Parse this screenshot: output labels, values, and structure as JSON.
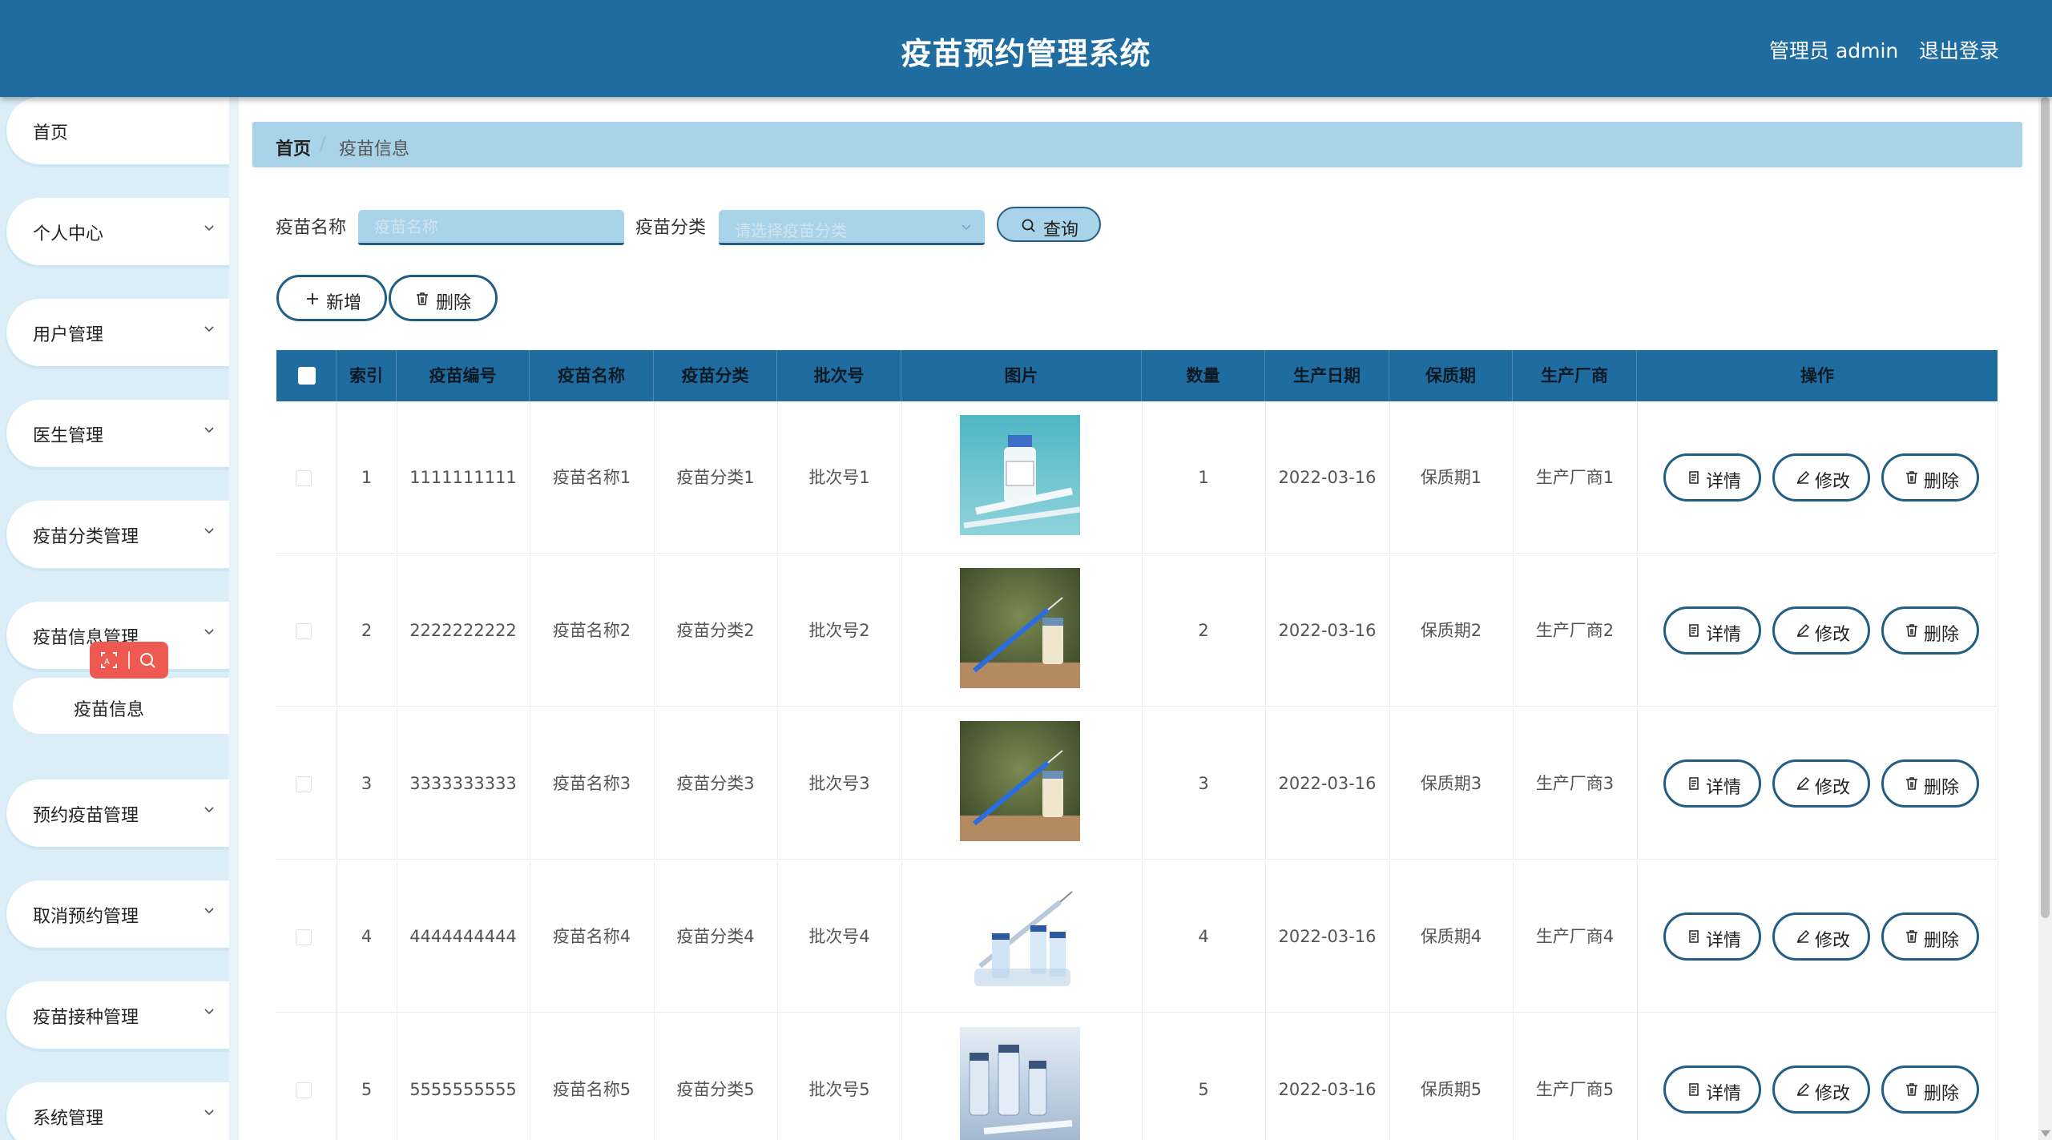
{
  "header": {
    "title": "疫苗预约管理系统",
    "admin": "管理员 admin",
    "logout": "退出登录"
  },
  "sidebar": {
    "items": [
      {
        "label": "首页",
        "has_arrow": false
      },
      {
        "label": "个人中心",
        "has_arrow": true
      },
      {
        "label": "用户管理",
        "has_arrow": true
      },
      {
        "label": "医生管理",
        "has_arrow": true
      },
      {
        "label": "疫苗分类管理",
        "has_arrow": true
      },
      {
        "label": "疫苗信息管理",
        "has_arrow": true
      },
      {
        "label": "预约疫苗管理",
        "has_arrow": true
      },
      {
        "label": "取消预约管理",
        "has_arrow": true
      },
      {
        "label": "疫苗接种管理",
        "has_arrow": true
      },
      {
        "label": "系统管理",
        "has_arrow": true
      }
    ],
    "sub_item": "疫苗信息"
  },
  "breadcrumb": {
    "home": "首页",
    "separator": "/",
    "current": "疫苗信息"
  },
  "search": {
    "name_label": "疫苗名称",
    "name_placeholder": "疫苗名称",
    "category_label": "疫苗分类",
    "category_placeholder": "请选择疫苗分类",
    "query_button": "查询"
  },
  "toolbar": {
    "add_button": "新增",
    "delete_button": "删除"
  },
  "table": {
    "headers": [
      "索引",
      "疫苗编号",
      "疫苗名称",
      "疫苗分类",
      "批次号",
      "图片",
      "数量",
      "生产日期",
      "保质期",
      "生产厂商",
      "操作"
    ],
    "actions": {
      "detail": "详情",
      "edit": "修改",
      "delete": "删除"
    },
    "rows": [
      {
        "index": "1",
        "code": "1111111111",
        "name": "疫苗名称1",
        "category": "疫苗分类1",
        "batch": "批次号1",
        "qty": "1",
        "date": "2022-03-16",
        "shelf": "保质期1",
        "maker": "生产厂商1",
        "image": "vial-teal"
      },
      {
        "index": "2",
        "code": "2222222222",
        "name": "疫苗名称2",
        "category": "疫苗分类2",
        "batch": "批次号2",
        "qty": "2",
        "date": "2022-03-16",
        "shelf": "保质期2",
        "maker": "生产厂商2",
        "image": "syringe-green"
      },
      {
        "index": "3",
        "code": "3333333333",
        "name": "疫苗名称3",
        "category": "疫苗分类3",
        "batch": "批次号3",
        "qty": "3",
        "date": "2022-03-16",
        "shelf": "保质期3",
        "maker": "生产厂商3",
        "image": "syringe-green"
      },
      {
        "index": "4",
        "code": "4444444444",
        "name": "疫苗名称4",
        "category": "疫苗分类4",
        "batch": "批次号4",
        "qty": "4",
        "date": "2022-03-16",
        "shelf": "保质期4",
        "maker": "生产厂商4",
        "image": "vials-white"
      },
      {
        "index": "5",
        "code": "5555555555",
        "name": "疫苗名称5",
        "category": "疫苗分类5",
        "batch": "批次号5",
        "qty": "5",
        "date": "2022-03-16",
        "shelf": "保质期5",
        "maker": "生产厂商5",
        "image": "vials-blue"
      }
    ]
  },
  "colors": {
    "primary": "#1f6ca1",
    "light": "#a9d3e8",
    "border": "#215d84",
    "sidebar_bg": "#dbeef7"
  }
}
